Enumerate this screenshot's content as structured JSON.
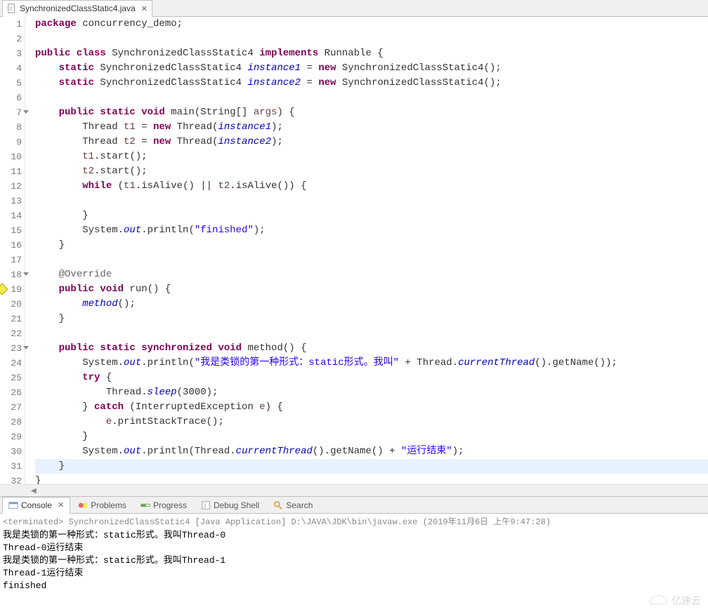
{
  "tab": {
    "filename": "SynchronizedClassStatic4.java"
  },
  "code": {
    "lines": [
      {
        "n": 1,
        "html": "<span class='kw'>package</span> concurrency_demo;"
      },
      {
        "n": 2,
        "html": ""
      },
      {
        "n": 3,
        "html": "<span class='kw'>public class</span> SynchronizedClassStatic4 <span class='kw'>implements</span> Runnable {"
      },
      {
        "n": 4,
        "html": "    <span class='kw'>static</span> SynchronizedClassStatic4 <span class='fld'>instance1</span> = <span class='kw'>new</span> SynchronizedClassStatic4();"
      },
      {
        "n": 5,
        "html": "    <span class='kw'>static</span> SynchronizedClassStatic4 <span class='fld'>instance2</span> = <span class='kw'>new</span> SynchronizedClassStatic4();"
      },
      {
        "n": 6,
        "html": ""
      },
      {
        "n": 7,
        "fold": true,
        "html": "    <span class='kw'>public static void</span> main(String[] <span class='param'>args</span>) {"
      },
      {
        "n": 8,
        "html": "        Thread <span class='param'>t1</span> = <span class='kw'>new</span> Thread(<span class='fld'>instance1</span>);"
      },
      {
        "n": 9,
        "html": "        Thread <span class='param'>t2</span> = <span class='kw'>new</span> Thread(<span class='fld'>instance2</span>);"
      },
      {
        "n": 10,
        "html": "        <span class='param'>t1</span>.start();"
      },
      {
        "n": 11,
        "html": "        <span class='param'>t2</span>.start();"
      },
      {
        "n": 12,
        "html": "        <span class='kw'>while</span> (<span class='param'>t1</span>.isAlive() || <span class='param'>t2</span>.isAlive()) {"
      },
      {
        "n": 13,
        "html": ""
      },
      {
        "n": 14,
        "html": "        }"
      },
      {
        "n": 15,
        "html": "        System.<span class='stat-it'>out</span>.println(<span class='str'>\"finished\"</span>);"
      },
      {
        "n": 16,
        "html": "    }"
      },
      {
        "n": 17,
        "html": ""
      },
      {
        "n": 18,
        "fold": true,
        "html": "    <span class='ann'>@Override</span>"
      },
      {
        "n": 19,
        "warn": true,
        "html": "    <span class='kw'>public void</span> run() {"
      },
      {
        "n": 20,
        "html": "        <span class='stat-it'>method</span>();"
      },
      {
        "n": 21,
        "html": "    }"
      },
      {
        "n": 22,
        "html": ""
      },
      {
        "n": 23,
        "fold": true,
        "html": "    <span class='kw'>public static synchronized void</span> method() {"
      },
      {
        "n": 24,
        "html": "        System.<span class='stat-it'>out</span>.println(<span class='str'>\"我是类锁的第一种形式：static形式。我叫\"</span> + Thread.<span class='stat-it'>currentThread</span>().getName());"
      },
      {
        "n": 25,
        "html": "        <span class='kw'>try</span> {"
      },
      {
        "n": 26,
        "html": "            Thread.<span class='stat-it'>sleep</span>(3000);"
      },
      {
        "n": 27,
        "html": "        } <span class='kw'>catch</span> (InterruptedException <span class='param'>e</span>) {"
      },
      {
        "n": 28,
        "html": "            <span class='param'>e</span>.printStackTrace();"
      },
      {
        "n": 29,
        "html": "        }"
      },
      {
        "n": 30,
        "html": "        System.<span class='stat-it'>out</span>.println(Thread.<span class='stat-it'>currentThread</span>().getName() + <span class='str'>\"运行结束\"</span>);"
      },
      {
        "n": 31,
        "hl": true,
        "html": "    }"
      },
      {
        "n": 32,
        "html": "}"
      }
    ]
  },
  "views": {
    "console": "Console",
    "problems": "Problems",
    "progress": "Progress",
    "debugShell": "Debug Shell",
    "search": "Search"
  },
  "console": {
    "terminated": "<terminated> SynchronizedClassStatic4 [Java Application] D:\\JAVA\\JDK\\bin\\javaw.exe (2019年11月6日 上午9:47:28)",
    "output": [
      "我是类锁的第一种形式：static形式。我叫Thread-0",
      "Thread-0运行结束",
      "我是类锁的第一种形式：static形式。我叫Thread-1",
      "Thread-1运行结束",
      "finished"
    ]
  },
  "watermark": "亿速云"
}
